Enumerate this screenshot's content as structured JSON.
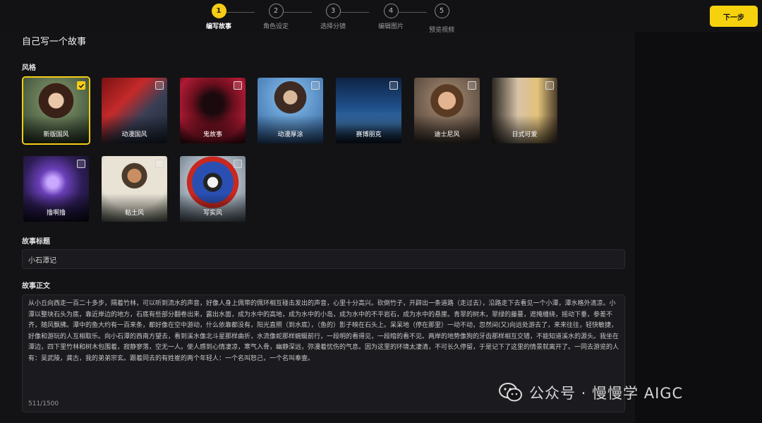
{
  "steps": [
    {
      "num": "1",
      "label": "编写故事"
    },
    {
      "num": "2",
      "label": "角色设定"
    },
    {
      "num": "3",
      "label": "选择分镜"
    },
    {
      "num": "4",
      "label": "编辑图片"
    },
    {
      "num": "5",
      "label": "预览视频"
    }
  ],
  "next_button": "下一步",
  "page_title": "自己写一个故事",
  "style_section_label": "风格",
  "styles": [
    {
      "label": "新版国风",
      "selected": true
    },
    {
      "label": "动漫国风",
      "selected": false
    },
    {
      "label": "鬼故事",
      "selected": false
    },
    {
      "label": "动漫厚涂",
      "selected": false
    },
    {
      "label": "赛博朋克",
      "selected": false
    },
    {
      "label": "迪士尼风",
      "selected": false
    },
    {
      "label": "日式可爱",
      "selected": false
    },
    {
      "label": "撸啊撸",
      "selected": false
    },
    {
      "label": "粘土风",
      "selected": false
    },
    {
      "label": "写实风",
      "selected": false
    }
  ],
  "story_title_label": "故事标题",
  "story_title_value": "小石潭记",
  "story_body_label": "故事正文",
  "story_body_value": "从小丘向西走一百二十多步，隔着竹林，可以听到流水的声音，好像人身上佩带的佩环相互碰击发出的声音，心里十分高兴。砍倒竹子，开辟出一条道路（走过去），沿路走下去看见一个小潭，潭水格外清凉。小潭以整块石头为底，靠近岸边的地方，石底有些部分翻卷出来，露出水面，成为水中的高地，成为水中的小岛，成为水中的不平岩石，成为水中的悬崖。青翠的树木，翠绿的藤蔓，遮掩缠绕，摇动下垂，参差不齐，随风飘拂。潭中的鱼大约有一百来条，都好像在空中游动，什么依靠都没有，阳光直照（到水底），（鱼的）影子映在石头上。呆呆地（停在那里）一动不动，忽然间(又)向远处游去了，来来往往，轻快敏捷，好像和游玩的人互相取乐。向小石潭的西南方望去，看到溪水像北斗星那样曲折，水流像蛇那样蜿蜒前行，一段明的看得见，一段暗的看不见。两岸的地势像狗的牙齿那样相互交错，不能知道溪水的源头。我坐在潭边，四下里竹林和树木包围着，寂静寥落，空无一人。使人感到心情凄凉，寒气入骨，幽静深远，弥漫着忧伤的气息。因为这里的环境太凄清，不可长久停留，于是记下了这里的情景就离开了。一同去游览的人有：吴武陵，龚古，我的弟弟宗玄。跟着同去的有姓崔的两个年轻人：一个名叫恕己，一个名叫奉壹。",
  "char_counter": "511/1500",
  "watermark_text": "公众号 · 慢慢学 AIGC",
  "colors": {
    "accent": "#f6cc15",
    "background": "#131316",
    "input_bg": "#1b1b1f"
  },
  "icons": [
    "wechat-icon",
    "checkbox-icon",
    "check-icon"
  ]
}
